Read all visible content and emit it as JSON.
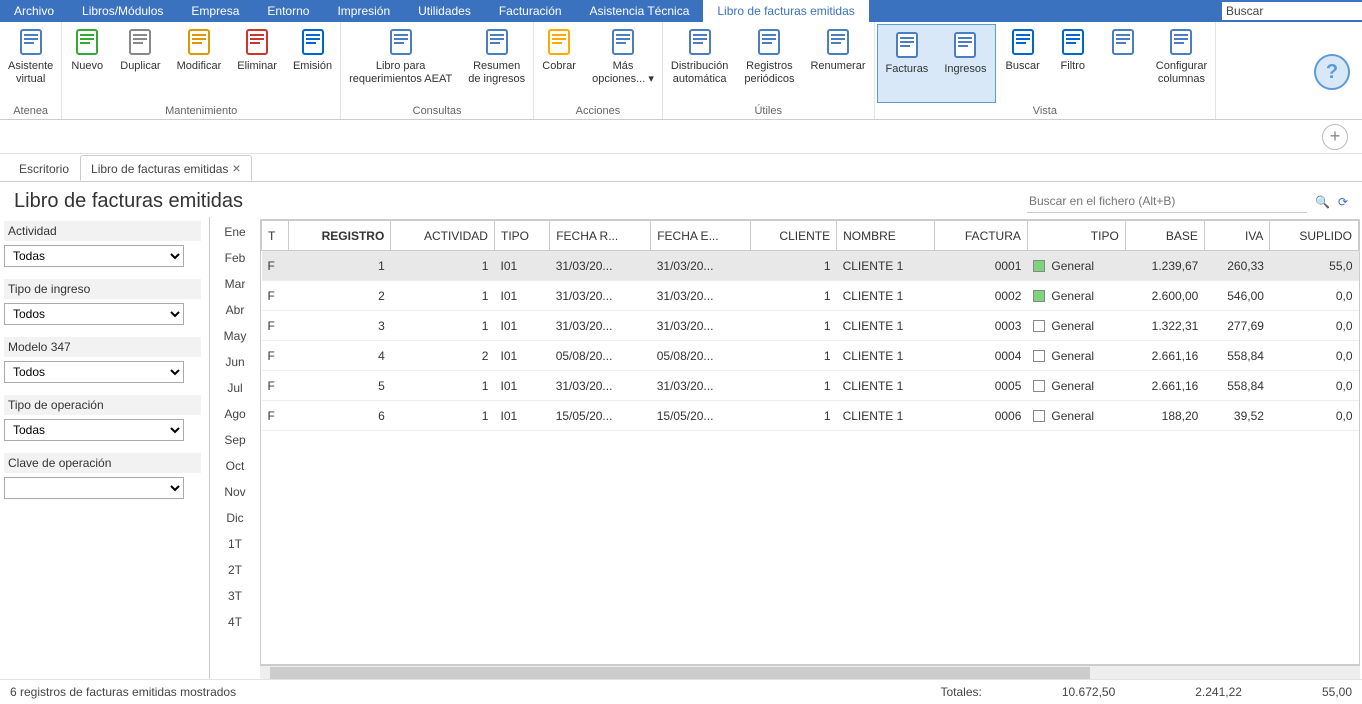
{
  "menubar": {
    "items": [
      "Archivo",
      "Libros/Módulos",
      "Empresa",
      "Entorno",
      "Impresión",
      "Utilidades",
      "Facturación",
      "Asistencia Técnica",
      "Libro de facturas emitidas"
    ],
    "active_index": 8,
    "search_placeholder": "Buscar"
  },
  "ribbon": {
    "groups": [
      {
        "label": "Atenea",
        "buttons": [
          {
            "name": "asistente",
            "label": "Asistente\nvirtual"
          }
        ]
      },
      {
        "label": "Mantenimiento",
        "buttons": [
          {
            "name": "nuevo",
            "label": "Nuevo"
          },
          {
            "name": "duplicar",
            "label": "Duplicar"
          },
          {
            "name": "modificar",
            "label": "Modificar"
          },
          {
            "name": "eliminar",
            "label": "Eliminar"
          },
          {
            "name": "emision",
            "label": "Emisión"
          }
        ]
      },
      {
        "label": "Consultas",
        "buttons": [
          {
            "name": "libro-aeat",
            "label": "Libro para\nrequerimientos AEAT"
          },
          {
            "name": "resumen-ingresos",
            "label": "Resumen\nde ingresos"
          }
        ]
      },
      {
        "label": "Acciones",
        "buttons": [
          {
            "name": "cobrar",
            "label": "Cobrar"
          },
          {
            "name": "mas-opciones",
            "label": "Más\nopciones... ▾"
          }
        ]
      },
      {
        "label": "Útiles",
        "buttons": [
          {
            "name": "distribucion",
            "label": "Distribución\nautomática"
          },
          {
            "name": "registros-periodicos",
            "label": "Registros\nperiódicos"
          },
          {
            "name": "renumerar",
            "label": "Renumerar"
          }
        ]
      },
      {
        "label": "Vista",
        "buttons": [
          {
            "name": "facturas",
            "label": "Facturas",
            "toggled": true
          },
          {
            "name": "ingresos",
            "label": "Ingresos",
            "toggled": true
          },
          {
            "name": "buscar",
            "label": "Buscar"
          },
          {
            "name": "filtro",
            "label": "Filtro"
          },
          {
            "name": "orden",
            "label": ""
          },
          {
            "name": "configurar-columnas",
            "label": "Configurar\ncolumnas"
          }
        ]
      }
    ]
  },
  "tabs": {
    "items": [
      {
        "label": "Escritorio",
        "closable": false
      },
      {
        "label": "Libro de facturas emitidas",
        "closable": true
      }
    ],
    "active_index": 1
  },
  "page": {
    "title": "Libro de facturas emitidas",
    "search_placeholder": "Buscar en el fichero (Alt+B)"
  },
  "sidebar": {
    "filters": [
      {
        "label": "Actividad",
        "value": "Todas"
      },
      {
        "label": "Tipo de ingreso",
        "value": "Todos"
      },
      {
        "label": "Modelo 347",
        "value": "Todos"
      },
      {
        "label": "Tipo de operación",
        "value": "Todas"
      },
      {
        "label": "Clave de operación",
        "value": ""
      }
    ]
  },
  "months": [
    "Ene",
    "Feb",
    "Mar",
    "Abr",
    "May",
    "Jun",
    "Jul",
    "Ago",
    "Sep",
    "Oct",
    "Nov",
    "Dic",
    "1T",
    "2T",
    "3T",
    "4T"
  ],
  "grid": {
    "columns": [
      "T",
      "REGISTRO",
      "ACTIVIDAD",
      "TIPO",
      "FECHA R...",
      "FECHA E...",
      "CLIENTE",
      "NOMBRE",
      "FACTURA",
      "TIPO",
      "BASE",
      "IVA",
      "SUPLIDO"
    ],
    "rows": [
      {
        "t": "F",
        "registro": "1",
        "actividad": "1",
        "tipo": "I01",
        "fechar": "31/03/20...",
        "fechae": "31/03/20...",
        "cliente": "1",
        "nombre": "CLIENTE 1",
        "factura": "0001",
        "tipo2": "General",
        "tipo2_green": true,
        "base": "1.239,67",
        "iva": "260,33",
        "suplido": "55,0",
        "selected": true
      },
      {
        "t": "F",
        "registro": "2",
        "actividad": "1",
        "tipo": "I01",
        "fechar": "31/03/20...",
        "fechae": "31/03/20...",
        "cliente": "1",
        "nombre": "CLIENTE 1",
        "factura": "0002",
        "tipo2": "General",
        "tipo2_green": true,
        "base": "2.600,00",
        "iva": "546,00",
        "suplido": "0,0"
      },
      {
        "t": "F",
        "registro": "3",
        "actividad": "1",
        "tipo": "I01",
        "fechar": "31/03/20...",
        "fechae": "31/03/20...",
        "cliente": "1",
        "nombre": "CLIENTE 1",
        "factura": "0003",
        "tipo2": "General",
        "tipo2_green": false,
        "base": "1.322,31",
        "iva": "277,69",
        "suplido": "0,0"
      },
      {
        "t": "F",
        "registro": "4",
        "actividad": "2",
        "tipo": "I01",
        "fechar": "05/08/20...",
        "fechae": "05/08/20...",
        "cliente": "1",
        "nombre": "CLIENTE 1",
        "factura": "0004",
        "tipo2": "General",
        "tipo2_green": false,
        "base": "2.661,16",
        "iva": "558,84",
        "suplido": "0,0"
      },
      {
        "t": "F",
        "registro": "5",
        "actividad": "1",
        "tipo": "I01",
        "fechar": "31/03/20...",
        "fechae": "31/03/20...",
        "cliente": "1",
        "nombre": "CLIENTE 1",
        "factura": "0005",
        "tipo2": "General",
        "tipo2_green": false,
        "base": "2.661,16",
        "iva": "558,84",
        "suplido": "0,0"
      },
      {
        "t": "F",
        "registro": "6",
        "actividad": "1",
        "tipo": "I01",
        "fechar": "15/05/20...",
        "fechae": "15/05/20...",
        "cliente": "1",
        "nombre": "CLIENTE 1",
        "factura": "0006",
        "tipo2": "General",
        "tipo2_green": false,
        "base": "188,20",
        "iva": "39,52",
        "suplido": "0,0"
      }
    ]
  },
  "status": {
    "text": "6 registros de facturas emitidas mostrados",
    "totals_label": "Totales:",
    "total_base": "10.672,50",
    "total_iva": "2.241,22",
    "total_suplido": "55,00"
  }
}
